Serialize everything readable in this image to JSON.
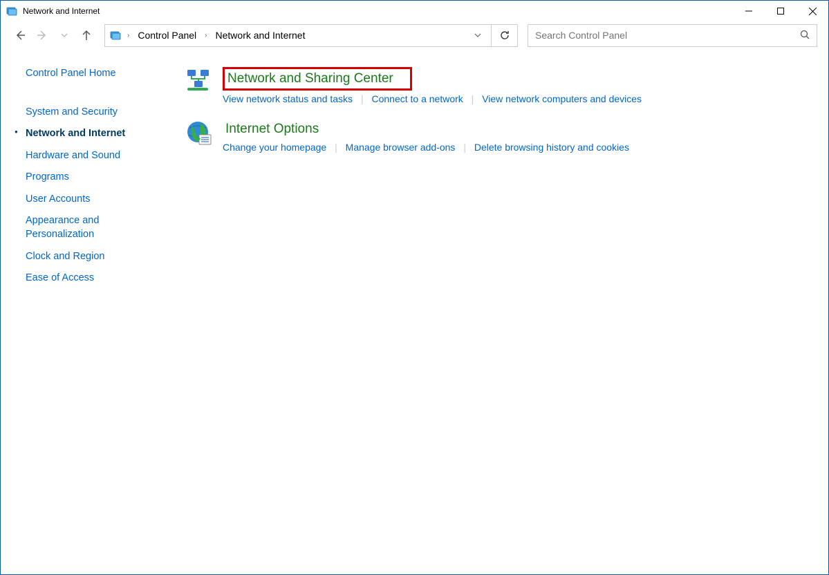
{
  "window": {
    "title": "Network and Internet"
  },
  "breadcrumb": {
    "items": [
      "Control Panel",
      "Network and Internet"
    ]
  },
  "search": {
    "placeholder": "Search Control Panel"
  },
  "sidebar": {
    "home": "Control Panel Home",
    "items": [
      {
        "label": "System and Security"
      },
      {
        "label": "Network and Internet",
        "current": true
      },
      {
        "label": "Hardware and Sound"
      },
      {
        "label": "Programs"
      },
      {
        "label": "User Accounts"
      },
      {
        "label": "Appearance and Personalization"
      },
      {
        "label": "Clock and Region"
      },
      {
        "label": "Ease of Access"
      }
    ]
  },
  "main": {
    "categories": [
      {
        "title": "Network and Sharing Center",
        "highlight": true,
        "links": [
          "View network status and tasks",
          "Connect to a network",
          "View network computers and devices"
        ]
      },
      {
        "title": "Internet Options",
        "highlight": false,
        "links": [
          "Change your homepage",
          "Manage browser add-ons",
          "Delete browsing history and cookies"
        ]
      }
    ]
  }
}
